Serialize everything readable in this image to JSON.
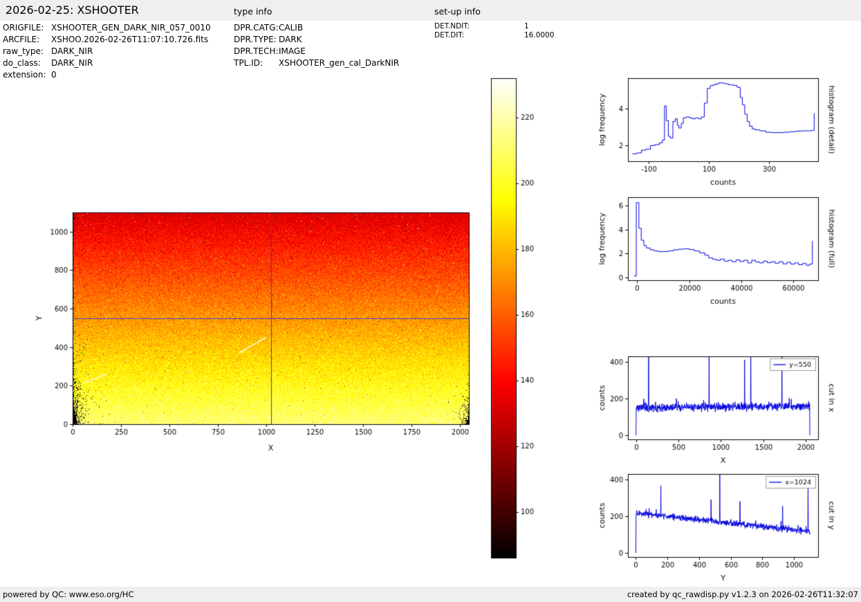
{
  "header": {
    "title": "2026-02-25: XSHOOTER",
    "type_info_label": "type info",
    "setup_info_label": "set-up info"
  },
  "metadata": {
    "left": [
      {
        "label": "ORIGFILE:",
        "value": "XSHOOTER_GEN_DARK_NIR_057_0010"
      },
      {
        "label": "ARCFILE:",
        "value": "XSHOO.2026-02-26T11:07:10.726.fits"
      },
      {
        "label": "raw_type:",
        "value": "DARK_NIR"
      },
      {
        "label": "do_class:",
        "value": "DARK_NIR"
      },
      {
        "label": "extension:",
        "value": "0"
      }
    ],
    "type": [
      {
        "label": "DPR.CATG:",
        "value": "CALIB"
      },
      {
        "label": "DPR.TYPE:",
        "value": "DARK"
      },
      {
        "label": "DPR.TECH:",
        "value": "IMAGE"
      },
      {
        "label": "TPL.ID:",
        "value": "XSHOOTER_gen_cal_DarkNIR"
      }
    ],
    "setup": [
      {
        "label": "DET.NDIT:",
        "value": "1"
      },
      {
        "label": "DET.DIT:",
        "value": "16.0000"
      }
    ]
  },
  "footer": {
    "left": "powered by QC: www.eso.org/HC",
    "right": "created by qc_rawdisp.py v1.2.3 on 2026-02-26T11:32:07"
  },
  "colors": {
    "line_blue": "#0000dd",
    "crosshair": "#3a3aca",
    "header_bg": "#efefef",
    "footer_bg": "#efefef",
    "legend_border": "#9a9a9a"
  },
  "chart_data": [
    {
      "type": "heatmap",
      "name": "raw-image",
      "xlabel": "X",
      "ylabel": "Y",
      "xlim": [
        0,
        2048
      ],
      "ylim": [
        0,
        1100
      ],
      "xticks": [
        0,
        250,
        500,
        750,
        1000,
        1250,
        1500,
        1750,
        2000
      ],
      "yticks": [
        0,
        200,
        400,
        600,
        800,
        1000
      ],
      "colormap": "hot",
      "gradient": {
        "value_bottom": 212,
        "value_top": 132,
        "noise_sigma": 7
      },
      "crosshair": {
        "x": 1024,
        "y": 550
      },
      "streaks": [
        {
          "x1": 858,
          "y1": 368,
          "x2": 1000,
          "y2": 452
        },
        {
          "x1": 54,
          "y1": 215,
          "x2": 178,
          "y2": 260
        }
      ],
      "colorbar": {
        "vmin": 86,
        "vmax": 232,
        "ticks": [
          100,
          120,
          140,
          160,
          180,
          200,
          220
        ]
      },
      "layout": {
        "ml": 65,
        "mt": 22,
        "mr": 22,
        "mb": 67,
        "xlabOff": 38,
        "ylabOff": 45
      },
      "seed": 1234
    },
    {
      "type": "line",
      "name": "histogram-detail",
      "title_right": "histogram (detail)",
      "xlabel": "counts",
      "ylabel": "log frequency",
      "xlim": [
        -170,
        465
      ],
      "ylim": [
        1.15,
        5.65
      ],
      "xticks": [
        -100,
        100,
        300
      ],
      "yticks": [
        2,
        4
      ],
      "grid": false,
      "step": true,
      "points": [
        [
          -155,
          1.55
        ],
        [
          -140,
          1.6
        ],
        [
          -125,
          1.75
        ],
        [
          -110,
          1.8
        ],
        [
          -95,
          2.0
        ],
        [
          -80,
          2.05
        ],
        [
          -65,
          2.15
        ],
        [
          -55,
          2.3
        ],
        [
          -48,
          4.15
        ],
        [
          -42,
          3.35
        ],
        [
          -35,
          2.5
        ],
        [
          -28,
          2.4
        ],
        [
          -20,
          3.3
        ],
        [
          -12,
          3.45
        ],
        [
          -5,
          3.1
        ],
        [
          0,
          2.95
        ],
        [
          8,
          3.2
        ],
        [
          15,
          3.5
        ],
        [
          25,
          3.55
        ],
        [
          35,
          3.5
        ],
        [
          45,
          3.45
        ],
        [
          55,
          3.5
        ],
        [
          65,
          3.45
        ],
        [
          75,
          3.55
        ],
        [
          85,
          4.3
        ],
        [
          95,
          5.1
        ],
        [
          105,
          5.25
        ],
        [
          115,
          5.3
        ],
        [
          125,
          5.35
        ],
        [
          135,
          5.4
        ],
        [
          145,
          5.38
        ],
        [
          155,
          5.35
        ],
        [
          165,
          5.3
        ],
        [
          175,
          5.28
        ],
        [
          185,
          5.25
        ],
        [
          195,
          5.15
        ],
        [
          205,
          4.6
        ],
        [
          212,
          4.2
        ],
        [
          220,
          3.7
        ],
        [
          228,
          3.3
        ],
        [
          236,
          3.05
        ],
        [
          245,
          2.9
        ],
        [
          255,
          2.85
        ],
        [
          270,
          2.8
        ],
        [
          290,
          2.72
        ],
        [
          310,
          2.7
        ],
        [
          330,
          2.7
        ],
        [
          350,
          2.72
        ],
        [
          370,
          2.75
        ],
        [
          390,
          2.78
        ],
        [
          410,
          2.8
        ],
        [
          430,
          2.8
        ],
        [
          445,
          2.82
        ],
        [
          452,
          3.75
        ]
      ],
      "layout": {
        "ml": 53,
        "mt": 13,
        "mr": 62,
        "mb": 53
      }
    },
    {
      "type": "line",
      "name": "histogram-full",
      "title_right": "histogram (full)",
      "xlabel": "counts",
      "ylabel": "log frequency",
      "xlim": [
        -3500,
        69500
      ],
      "ylim": [
        -0.25,
        6.7
      ],
      "xticks": [
        0,
        20000,
        40000,
        60000
      ],
      "yticks": [
        0,
        2,
        4,
        6
      ],
      "grid": false,
      "step": true,
      "points": [
        [
          -1200,
          0.1
        ],
        [
          -300,
          6.25
        ],
        [
          700,
          4.1
        ],
        [
          1600,
          3.1
        ],
        [
          2600,
          2.65
        ],
        [
          3600,
          2.45
        ],
        [
          5000,
          2.3
        ],
        [
          6500,
          2.2
        ],
        [
          8000,
          2.15
        ],
        [
          10000,
          2.15
        ],
        [
          12000,
          2.2
        ],
        [
          14000,
          2.3
        ],
        [
          16000,
          2.35
        ],
        [
          18000,
          2.38
        ],
        [
          20000,
          2.32
        ],
        [
          22000,
          2.2
        ],
        [
          24000,
          2.05
        ],
        [
          26000,
          1.85
        ],
        [
          27500,
          1.62
        ],
        [
          29000,
          1.5
        ],
        [
          30500,
          1.42
        ],
        [
          32000,
          1.52
        ],
        [
          33500,
          1.35
        ],
        [
          35000,
          1.42
        ],
        [
          36500,
          1.3
        ],
        [
          38000,
          1.45
        ],
        [
          39500,
          1.32
        ],
        [
          41000,
          1.42
        ],
        [
          42500,
          1.2
        ],
        [
          44000,
          1.42
        ],
        [
          45500,
          1.28
        ],
        [
          47000,
          1.2
        ],
        [
          48500,
          1.35
        ],
        [
          50000,
          1.22
        ],
        [
          51500,
          1.3
        ],
        [
          53000,
          1.18
        ],
        [
          54500,
          1.3
        ],
        [
          56000,
          1.12
        ],
        [
          57500,
          1.25
        ],
        [
          59000,
          1.1
        ],
        [
          60500,
          1.2
        ],
        [
          62000,
          1.05
        ],
        [
          63500,
          1.15
        ],
        [
          65000,
          1.0
        ],
        [
          66200,
          1.1
        ],
        [
          67300,
          3.05
        ]
      ],
      "layout": {
        "ml": 53,
        "mt": 13,
        "mr": 62,
        "mb": 53
      }
    },
    {
      "type": "line",
      "name": "cut-in-x",
      "title_right": "cut in x",
      "xlabel": "X",
      "ylabel": "counts",
      "xlim": [
        -95,
        2145
      ],
      "ylim": [
        -22,
        432
      ],
      "xticks": [
        0,
        500,
        1000,
        1500,
        2000
      ],
      "yticks": [
        0,
        200,
        400
      ],
      "legend": "y=550",
      "legend_position": "upper right",
      "signal": {
        "x_start": 0,
        "x_end": 2048,
        "n": 760,
        "baseline_start": 152,
        "baseline_end": 160,
        "noise": 11,
        "zero_start": true,
        "zero_end": true,
        "spikes": [
          {
            "x": 148,
            "v": 470
          },
          {
            "x": 860,
            "v": 430
          },
          {
            "x": 1278,
            "v": 412
          },
          {
            "x": 1352,
            "v": 470
          },
          {
            "x": 1720,
            "v": 438
          }
        ]
      },
      "layout": {
        "ml": 53,
        "mt": 13,
        "mr": 62,
        "mb": 53
      },
      "seed": 11
    },
    {
      "type": "line",
      "name": "cut-in-y",
      "title_right": "cut in y",
      "xlabel": "Y",
      "ylabel": "counts",
      "xlim": [
        -50,
        1152
      ],
      "ylim": [
        -22,
        432
      ],
      "xticks": [
        0,
        200,
        400,
        600,
        800,
        1000
      ],
      "yticks": [
        0,
        200,
        400
      ],
      "legend": "x=1024",
      "legend_position": "upper right",
      "signal": {
        "x_start": 0,
        "x_end": 1100,
        "n": 760,
        "baseline_start": 220,
        "baseline_end": 118,
        "noise": 8,
        "zero_start": true,
        "zero_end": false,
        "spikes": [
          {
            "x": 158,
            "v": 368
          },
          {
            "x": 476,
            "v": 292
          },
          {
            "x": 530,
            "v": 430
          },
          {
            "x": 658,
            "v": 282
          },
          {
            "x": 928,
            "v": 256
          },
          {
            "x": 1088,
            "v": 382
          }
        ]
      },
      "layout": {
        "ml": 53,
        "mt": 13,
        "mr": 62,
        "mb": 53
      },
      "seed": 12
    }
  ]
}
